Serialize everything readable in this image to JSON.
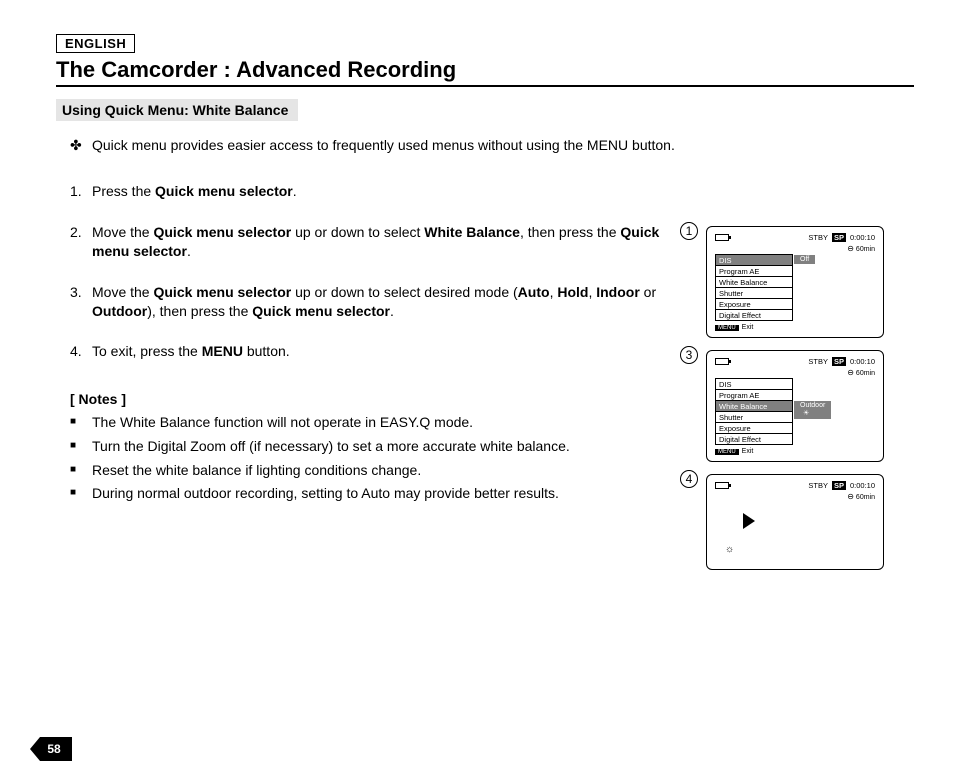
{
  "language_label": "ENGLISH",
  "title": "The Camcorder : Advanced Recording",
  "section": "Using Quick Menu: White Balance",
  "intro_marker": "✤",
  "intro": "Quick menu provides easier access to frequently used menus without using the MENU button.",
  "steps": [
    {
      "n": "1.",
      "pre": "Press the ",
      "b1": "Quick menu selector",
      "post1": "."
    },
    {
      "n": "2.",
      "pre": "Move the ",
      "b1": "Quick menu selector",
      "mid1": " up or down to select ",
      "b2": "White Balance",
      "mid2": ", then press the ",
      "b3": "Quick menu selector",
      "post1": "."
    },
    {
      "n": "3.",
      "pre": "Move the ",
      "b1": "Quick menu selector",
      "mid1": " up or down to select desired mode (",
      "b2": "Auto",
      "mid2": ", ",
      "b3": "Hold",
      "mid3": ", ",
      "b4": "Indoor",
      "mid4": " or ",
      "b5": "Outdoor",
      "mid5": "), then press the ",
      "b6": "Quick menu selector",
      "post1": "."
    },
    {
      "n": "4.",
      "pre": "To exit, press the ",
      "b1": "MENU",
      "post1": " button."
    }
  ],
  "notes_title": "[ Notes ]",
  "notes": [
    "The White Balance function will not operate in EASY.Q mode.",
    "Turn the Digital Zoom off (if necessary) to set a more accurate white balance.",
    "Reset the white balance if lighting conditions change.",
    "During normal outdoor recording, setting to Auto may provide better results."
  ],
  "figures": {
    "common": {
      "status": "STBY",
      "sp": "SP",
      "time": "0:00:10",
      "remain": "60min",
      "menu_badge": "MENU",
      "exit": "Exit"
    },
    "f1": {
      "num": "1",
      "items": [
        "DIS",
        "Program AE",
        "White Balance",
        "Shutter",
        "Exposure",
        "Digital Effect"
      ],
      "hl_index": 0,
      "value": "Off"
    },
    "f3": {
      "num": "3",
      "items": [
        "DIS",
        "Program AE",
        "White Balance",
        "Shutter",
        "Exposure",
        "Digital Effect"
      ],
      "hl_index": 2,
      "value": "Outdoor"
    },
    "f4": {
      "num": "4"
    }
  },
  "page_number": "58"
}
